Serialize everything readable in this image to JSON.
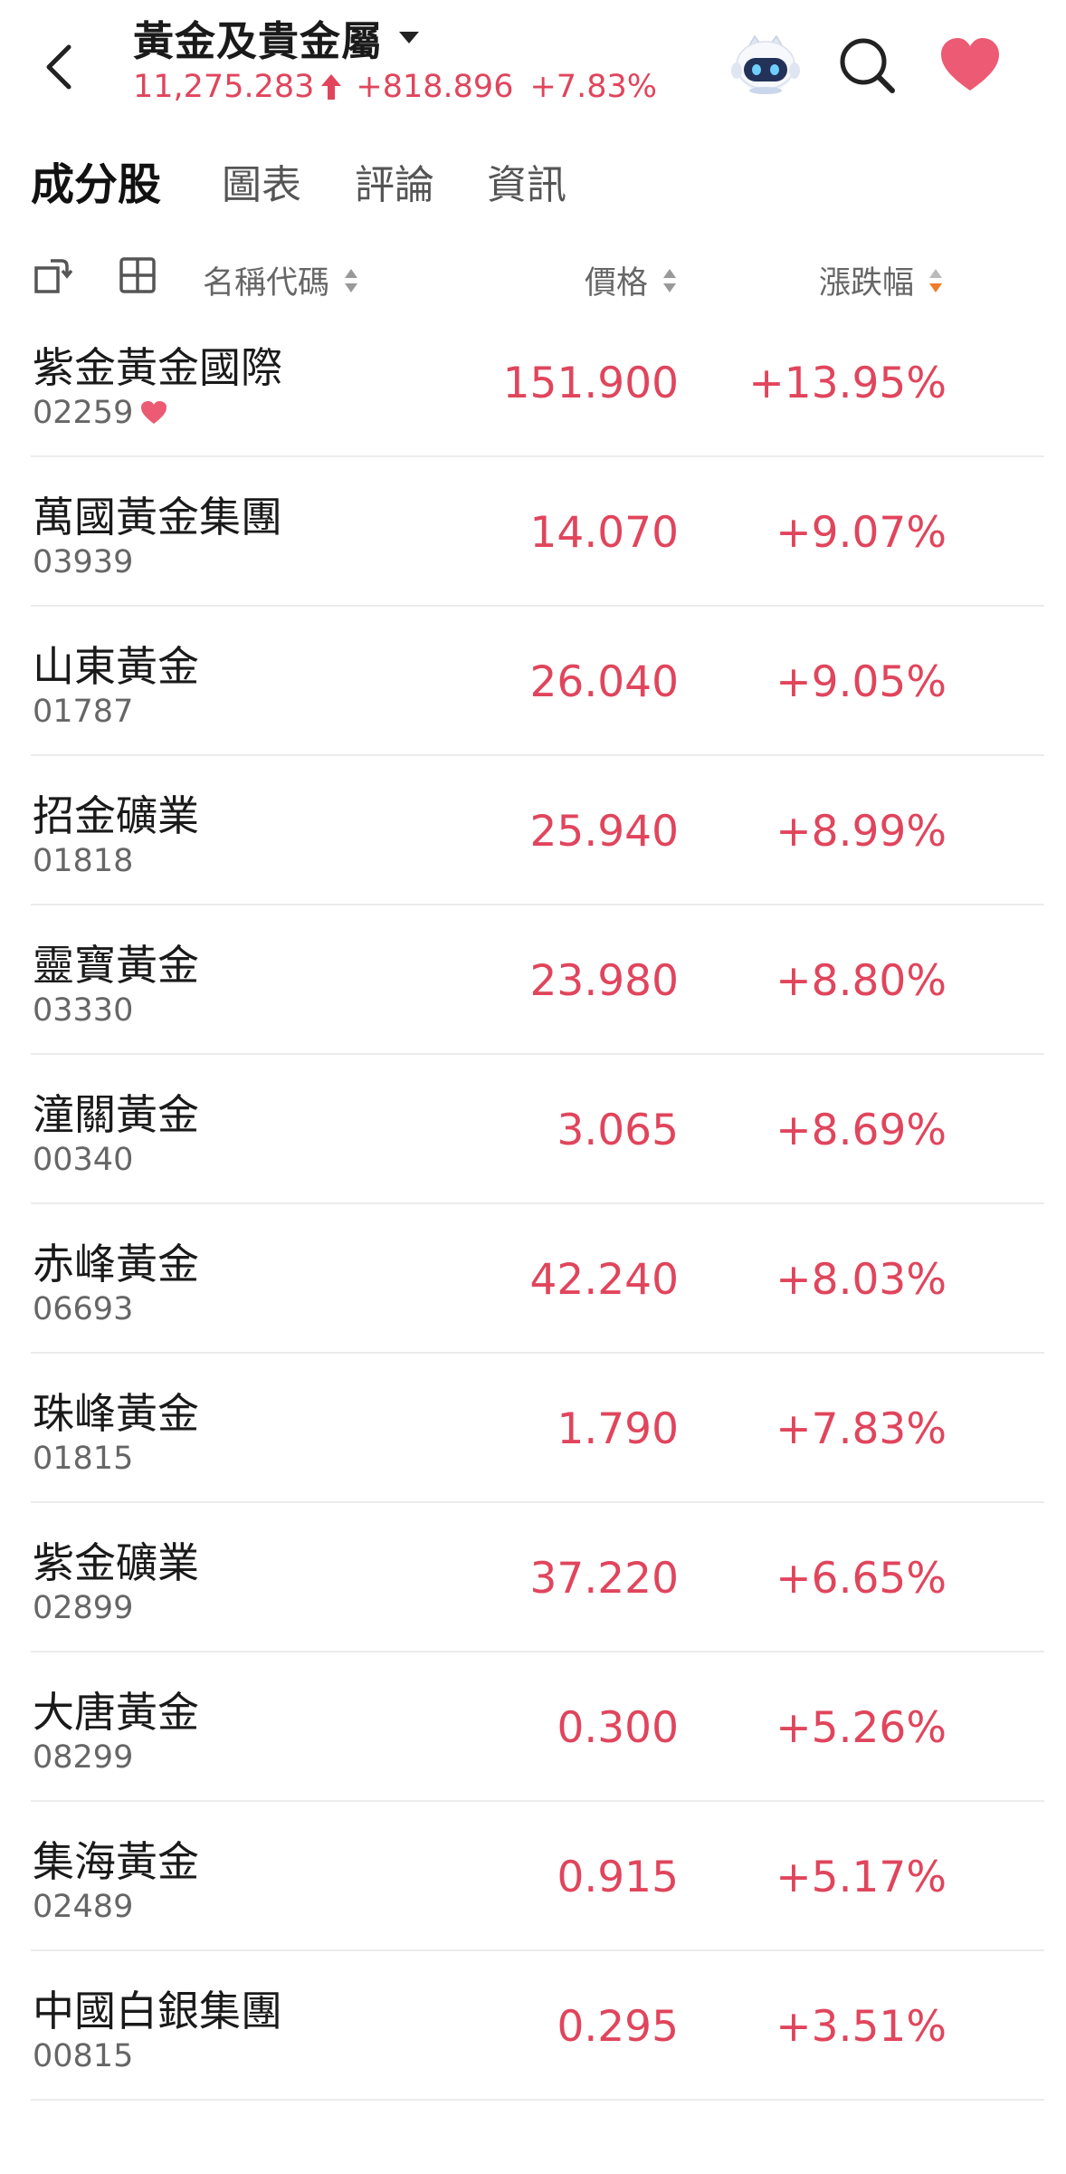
{
  "header": {
    "title": "黃金及貴金屬",
    "price": "11,275.283",
    "change": "+818.896",
    "change_pct": "+7.83%",
    "accent_color": "#e0455c",
    "icons": [
      "back-icon",
      "chevron-down-icon",
      "up-arrow-icon",
      "robot-assistant-icon",
      "search-icon",
      "heart-icon"
    ]
  },
  "tabs": [
    {
      "label": "成分股",
      "active": true
    },
    {
      "label": "圖表",
      "active": false
    },
    {
      "label": "評論",
      "active": false
    },
    {
      "label": "資訊",
      "active": false
    }
  ],
  "columns": {
    "name": "名稱代碼",
    "price": "價格",
    "change": "漲跌幅"
  },
  "stocks": [
    {
      "name": "紫金黃金國際",
      "code": "02259",
      "price": "151.900",
      "change": "+13.95%",
      "favorite": true
    },
    {
      "name": "萬國黃金集團",
      "code": "03939",
      "price": "14.070",
      "change": "+9.07%"
    },
    {
      "name": "山東黃金",
      "code": "01787",
      "price": "26.040",
      "change": "+9.05%"
    },
    {
      "name": "招金礦業",
      "code": "01818",
      "price": "25.940",
      "change": "+8.99%"
    },
    {
      "name": "靈寶黃金",
      "code": "03330",
      "price": "23.980",
      "change": "+8.80%"
    },
    {
      "name": "潼關黃金",
      "code": "00340",
      "price": "3.065",
      "change": "+8.69%"
    },
    {
      "name": "赤峰黃金",
      "code": "06693",
      "price": "42.240",
      "change": "+8.03%"
    },
    {
      "name": "珠峰黃金",
      "code": "01815",
      "price": "1.790",
      "change": "+7.83%"
    },
    {
      "name": "紫金礦業",
      "code": "02899",
      "price": "37.220",
      "change": "+6.65%"
    },
    {
      "name": "大唐黃金",
      "code": "08299",
      "price": "0.300",
      "change": "+5.26%"
    },
    {
      "name": "集海黃金",
      "code": "02489",
      "price": "0.915",
      "change": "+5.17%"
    },
    {
      "name": "中國白銀集團",
      "code": "00815",
      "price": "0.295",
      "change": "+3.51%"
    }
  ]
}
